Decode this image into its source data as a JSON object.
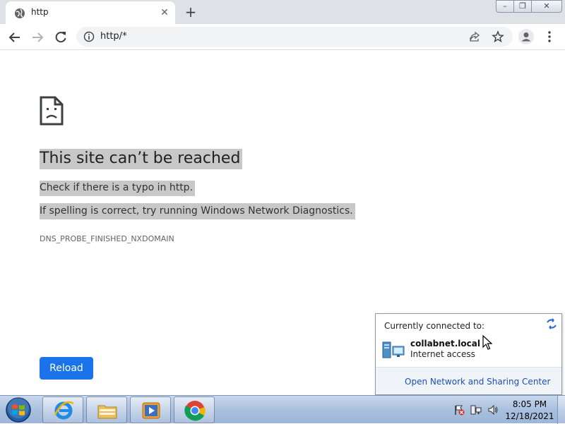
{
  "browser": {
    "tab": {
      "title": "http",
      "favicon": "globe-icon"
    },
    "address_bar": {
      "value": "http/*"
    },
    "window_controls": {
      "minimize": "–",
      "restore": "❐",
      "close": "✕"
    }
  },
  "error_page": {
    "title": "This site can’t be reached",
    "line1": "Check if there is a typo in http.",
    "line2": "If spelling is correct, try running Windows Network Diagnostics.",
    "code": "DNS_PROBE_FINISHED_NXDOMAIN",
    "reload_label": "Reload"
  },
  "network_flyout": {
    "heading": "Currently connected to:",
    "network_name": "collabnet.local",
    "network_status": "Internet access",
    "link": "Open Network and Sharing Center"
  },
  "taskbar": {
    "apps": [
      "internet-explorer",
      "file-explorer",
      "media-player",
      "chrome"
    ],
    "clock_time": "8:05 PM",
    "clock_date": "12/18/2021"
  },
  "colors": {
    "accent": "#1a73e8",
    "highlight": "#c8c8c8",
    "link": "#1b4fb5"
  }
}
